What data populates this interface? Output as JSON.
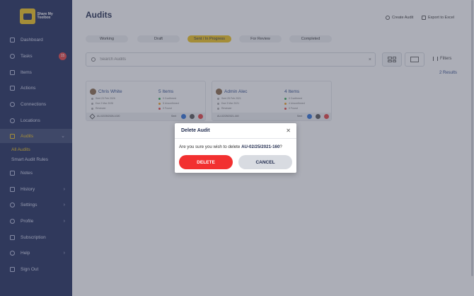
{
  "sidebar": {
    "logo_text": "Share My Toolbox",
    "items": [
      {
        "label": "Dashboard",
        "icon": "dashboard-icon"
      },
      {
        "label": "Tasks",
        "icon": "tasks-icon",
        "badge": "15"
      },
      {
        "label": "Items",
        "icon": "items-icon"
      },
      {
        "label": "Actions",
        "icon": "actions-icon"
      },
      {
        "label": "Connections",
        "icon": "connections-icon"
      },
      {
        "label": "Locations",
        "icon": "location-pin-icon"
      },
      {
        "label": "Audits",
        "icon": "audits-icon"
      },
      {
        "label": "Notes",
        "icon": "notes-icon"
      },
      {
        "label": "History",
        "icon": "history-icon"
      },
      {
        "label": "Settings",
        "icon": "gear-icon"
      },
      {
        "label": "Profile",
        "icon": "profile-icon"
      },
      {
        "label": "Subscription",
        "icon": "subscription-icon"
      },
      {
        "label": "Help",
        "icon": "help-icon"
      },
      {
        "label": "Sign Out",
        "icon": "sign-out-icon"
      }
    ],
    "audits_sub": [
      "All Audits",
      "Smart Audit Rules"
    ]
  },
  "header": {
    "title": "Audits",
    "create_audit": "Create Audit",
    "export_excel": "Export to Excel"
  },
  "tabs": [
    "Working",
    "Draft",
    "Sent / In Progress",
    "For Review",
    "Completed"
  ],
  "active_tab": "Sent / In Progress",
  "search": {
    "placeholder": "Search Audits",
    "value": ""
  },
  "filters_label": "Filters",
  "results": "2 Results",
  "cards": [
    {
      "name": "Chris White",
      "items": "5 Items",
      "sent": "Sent 23 Feb 2026",
      "due": "Due 2 Mar 2026",
      "reviewer": "Reviewer",
      "confirmed": "0 Confirmed",
      "unconfirmed": "5 Unconfirmed",
      "found": "0 Found",
      "audit_id": "AU-02/25/2026-1020",
      "status": "Sent"
    },
    {
      "name": "Admin Alec",
      "items": "4 Items",
      "sent": "Sent 25 Feb 2021",
      "due": "Due 3 Mar 2021",
      "reviewer": "Reviewer",
      "confirmed": "0 Confirmed",
      "unconfirmed": "4 Unconfirmed",
      "found": "0 Found",
      "audit_id": "AU-02/25/2021-160",
      "status": "Sent"
    }
  ],
  "modal": {
    "title": "Delete Audit",
    "message_prefix": "Are you sure you wish to delete ",
    "audit_id": "AU-02/25/2021-160",
    "message_suffix": "?",
    "delete_label": "DELETE",
    "cancel_label": "CANCEL"
  },
  "colors": {
    "sidebar_bg": "#1e2a5a",
    "accent": "#f0c419",
    "delete": "#f23030"
  }
}
